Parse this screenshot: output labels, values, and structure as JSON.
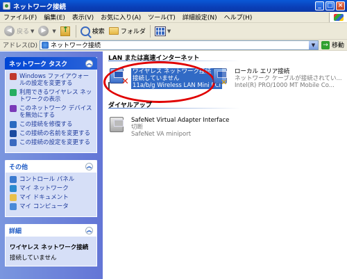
{
  "window": {
    "title": "ネットワーク接続",
    "buttons": {
      "minimize": "_",
      "maximize": "□",
      "close": "×"
    }
  },
  "menubar": {
    "items": [
      "ファイル(F)",
      "編集(E)",
      "表示(V)",
      "お気に入り(A)",
      "ツール(T)",
      "詳細設定(N)",
      "ヘルプ(H)"
    ]
  },
  "toolbar": {
    "back_label": "戻る",
    "search_label": "検索",
    "folders_label": "フォルダ"
  },
  "addressbar": {
    "label": "アドレス(D)",
    "value": "ネットワーク接続",
    "go_label": "移動"
  },
  "leftpane": {
    "network_tasks": {
      "title": "ネットワーク タスク",
      "items": [
        {
          "label": "Windows ファイアウォールの設定を変更する",
          "icon": "firewall-icon",
          "color": "#c0392b"
        },
        {
          "label": "利用できるワイヤレス ネットワークの表示",
          "icon": "wireless-icon",
          "color": "#27ae60"
        },
        {
          "label": "このネットワーク デバイスを無効にする",
          "icon": "disable-icon",
          "color": "#7a3ab8"
        },
        {
          "label": "この接続を修復する",
          "icon": "repair-icon",
          "color": "#2a6ac0"
        },
        {
          "label": "この接続の名前を変更する",
          "icon": "rename-icon",
          "color": "#1a4aa0"
        },
        {
          "label": "この接続の設定を変更する",
          "icon": "settings-icon",
          "color": "#3a6ac0"
        }
      ]
    },
    "other_places": {
      "title": "その他",
      "items": [
        {
          "label": "コントロール パネル",
          "icon": "control-panel-icon",
          "color": "#3a7ad0"
        },
        {
          "label": "マイ ネットワーク",
          "icon": "my-network-icon",
          "color": "#2a8ad0"
        },
        {
          "label": "マイ ドキュメント",
          "icon": "my-documents-icon",
          "color": "#e8c04a"
        },
        {
          "label": "マイ コンピュータ",
          "icon": "my-computer-icon",
          "color": "#4a8ad8"
        }
      ]
    },
    "details": {
      "title": "詳細",
      "name": "ワイヤレス ネットワーク接続",
      "status": "接続していません"
    }
  },
  "main": {
    "lan_group": {
      "title": "LAN または高速インターネット",
      "connections": [
        {
          "name": "ワイヤレス ネットワーク接続",
          "status": "接続していません",
          "device": "11a/b/g Wireless LAN Mini PCI"
        },
        {
          "name": "ローカル エリア接続",
          "status": "ネットワーク ケーブルが接続されてい...",
          "device": "Intel(R) PRO/1000 MT Mobile Co..."
        }
      ]
    },
    "dialup_group": {
      "title": "ダイヤルアップ",
      "connections": [
        {
          "name": "SafeNet Virtual Adapter Interface",
          "status": "切断",
          "device": "SafeNet VA miniport"
        }
      ]
    },
    "highlight_color": "#e00000"
  }
}
